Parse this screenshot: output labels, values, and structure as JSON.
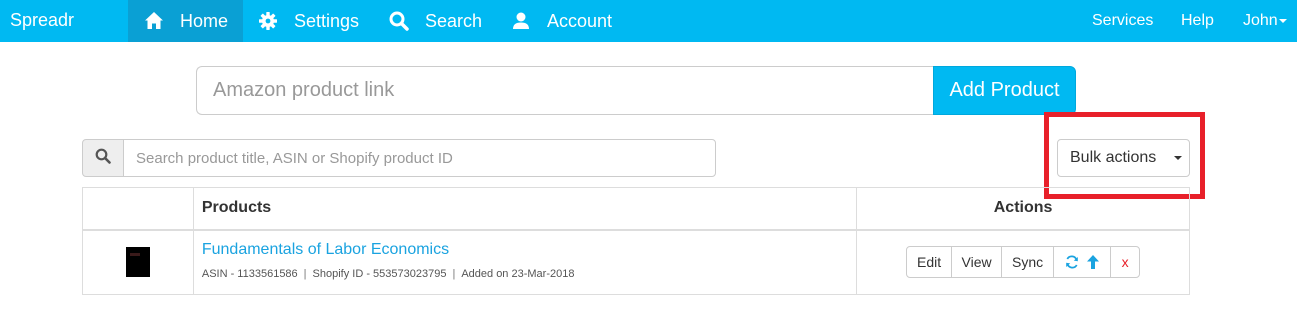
{
  "navbar": {
    "brand": "Spreadr",
    "items": [
      {
        "label": "Home",
        "icon": "home-icon"
      },
      {
        "label": "Settings",
        "icon": "gear-icon"
      },
      {
        "label": "Search",
        "icon": "search-icon"
      },
      {
        "label": "Account",
        "icon": "user-icon"
      }
    ],
    "right": {
      "services": "Services",
      "help": "Help",
      "user": "John"
    },
    "color": "#00b9f2",
    "active_color": "#0aa0d4"
  },
  "add_product": {
    "input_placeholder": "Amazon product link",
    "input_value": "",
    "button_label": "Add Product"
  },
  "search": {
    "placeholder": "Search product title, ASIN or Shopify product ID",
    "value": "",
    "icon": "search-icon"
  },
  "bulk_actions": {
    "label": "Bulk actions",
    "highlight_color": "#e8202a"
  },
  "table": {
    "headers": {
      "image": "",
      "products": "Products",
      "actions": "Actions"
    },
    "rows": [
      {
        "title": "Fundamentals of Labor Economics",
        "asin": "ASIN - 1133561586",
        "shopify_id": "Shopify ID - 553573023795",
        "added": "Added on 23-Mar-2018",
        "actions": {
          "edit": "Edit",
          "view": "View",
          "sync": "Sync",
          "delete": "x"
        }
      }
    ]
  }
}
